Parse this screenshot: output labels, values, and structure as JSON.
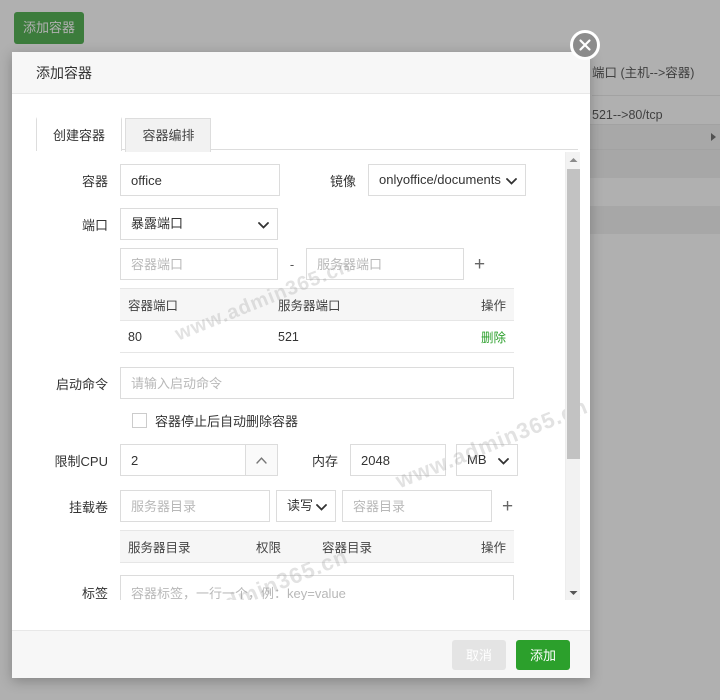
{
  "background": {
    "add_container_button": "添加容器",
    "table": {
      "header": "端口 (主机-->容器)",
      "rows": [
        "521-->80/tcp"
      ]
    }
  },
  "watermark": {
    "text": "www.admin365.cn"
  },
  "dialog": {
    "title": "添加容器",
    "close_icon": "close-icon",
    "tabs": [
      {
        "label": "创建容器",
        "active": true
      },
      {
        "label": "容器编排",
        "active": false
      }
    ],
    "fields": {
      "container": {
        "label": "容器",
        "value": "office"
      },
      "image": {
        "label": "镜像",
        "value": "onlyoffice/documents",
        "chevron_icon": "chevron-down-icon"
      },
      "port": {
        "label": "端口",
        "mode_value": "暴露端口",
        "container_port_placeholder": "容器端口",
        "server_port_placeholder": "服务器端口",
        "separator": "-",
        "add_icon": "plus-icon",
        "table": {
          "headers": [
            "容器端口",
            "服务器端口",
            "操作"
          ],
          "rows": [
            {
              "container_port": "80",
              "server_port": "521",
              "action": "删除"
            }
          ]
        }
      },
      "start_command": {
        "label": "启动命令",
        "placeholder": "请输入启动命令",
        "value": ""
      },
      "auto_remove": {
        "label": "容器停止后自动删除容器",
        "checked": false
      },
      "cpu_limit": {
        "label": "限制CPU",
        "value": "2",
        "spinner_icon": "caret-up-icon"
      },
      "memory": {
        "label": "内存",
        "value": "2048",
        "unit": "MB",
        "chevron_icon": "chevron-down-icon"
      },
      "volumes": {
        "label": "挂载卷",
        "server_dir_placeholder": "服务器目录",
        "permission_value": "读写",
        "container_dir_placeholder": "容器目录",
        "add_icon": "plus-icon",
        "table": {
          "headers": [
            "服务器目录",
            "权限",
            "容器目录",
            "操作"
          ],
          "rows": []
        }
      },
      "labels": {
        "label": "标签",
        "placeholder": "容器标签，一行一个，例：key=value",
        "value": ""
      }
    },
    "scrollbar": {
      "up_icon": "caret-up-icon",
      "down_icon": "caret-down-icon"
    },
    "footer": {
      "cancel_label": "取消",
      "submit_label": "添加"
    }
  },
  "colors": {
    "green": "#2ca02c",
    "cancel_gray": "#e4e4e4",
    "header_bg": "#f7f7f7"
  }
}
